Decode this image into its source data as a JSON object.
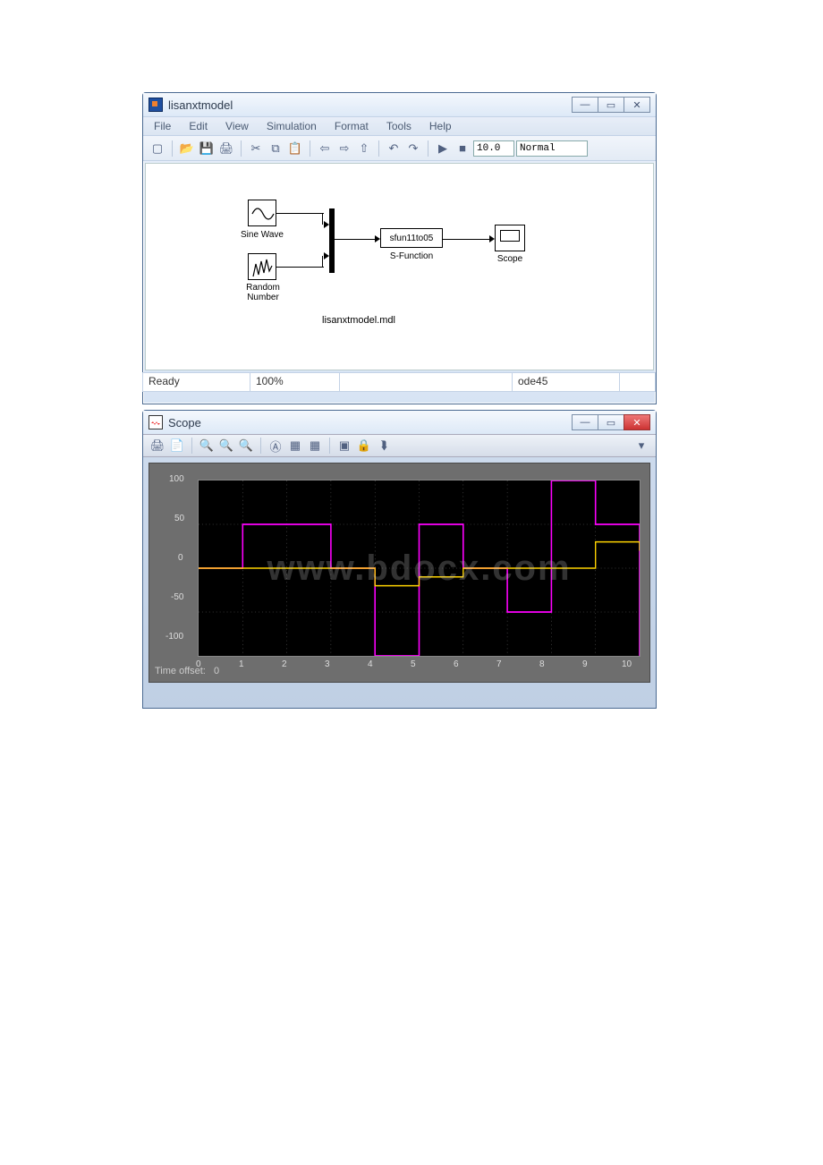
{
  "model_window": {
    "title": "lisanxtmodel",
    "menus": [
      "File",
      "Edit",
      "View",
      "Simulation",
      "Format",
      "Tools",
      "Help"
    ],
    "stop_time": "10.0",
    "mode": "Normal",
    "blocks": {
      "sine": "Sine Wave",
      "random": "Random\nNumber",
      "sfun": "sfun11to05",
      "sfun_type": "S-Function",
      "scope": "Scope"
    },
    "canvas_caption": "lisanxtmodel.mdl",
    "status": {
      "msg": "Ready",
      "zoom": "100%",
      "solver": "ode45"
    }
  },
  "scope_window": {
    "title": "Scope",
    "time_offset_label": "Time offset:",
    "time_offset_value": "0"
  },
  "chart_data": {
    "type": "line",
    "title": "",
    "xlabel": "",
    "ylabel": "",
    "xlim": [
      0,
      10
    ],
    "ylim": [
      -100,
      100
    ],
    "xticks": [
      0,
      1,
      2,
      3,
      4,
      5,
      6,
      7,
      8,
      9,
      10
    ],
    "yticks": [
      -100,
      -50,
      0,
      50,
      100
    ],
    "grid": true,
    "series": [
      {
        "name": "magenta-step",
        "color": "#ff00ff",
        "style": "step",
        "x": [
          0,
          1,
          2,
          3,
          4,
          5,
          6,
          7,
          8,
          9,
          10
        ],
        "y": [
          0,
          50,
          50,
          0,
          -100,
          50,
          0,
          -50,
          100,
          50,
          -100
        ]
      },
      {
        "name": "yellow-step",
        "color": "#ffd400",
        "style": "step",
        "x": [
          0,
          1,
          2,
          3,
          4,
          5,
          6,
          7,
          8,
          9,
          10
        ],
        "y": [
          0,
          0,
          0,
          0,
          -20,
          -10,
          0,
          0,
          0,
          30,
          20
        ]
      }
    ]
  }
}
